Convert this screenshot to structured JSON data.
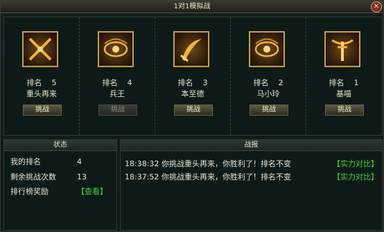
{
  "window": {
    "title": "1对1模拟战",
    "close_icon": "close-icon"
  },
  "colors": {
    "gold_frame": "#c89e4c",
    "link_green": "#39d43a",
    "panel_bg": "#0d1a18"
  },
  "opponents": [
    {
      "rank_label": "排名",
      "rank": "5",
      "name": "重头再来",
      "button": "挑战",
      "button_enabled": true,
      "icon": "crossed-swords-icon"
    },
    {
      "rank_label": "排名",
      "rank": "4",
      "name": "兵王",
      "button": "挑战",
      "button_enabled": false,
      "icon": "mystic-eye-icon"
    },
    {
      "rank_label": "排名",
      "rank": "3",
      "name": "本至德",
      "button": "挑战",
      "button_enabled": true,
      "icon": "curved-blade-icon"
    },
    {
      "rank_label": "排名",
      "rank": "2",
      "name": "马小玲",
      "button": "挑战",
      "button_enabled": true,
      "icon": "mystic-eye-icon"
    },
    {
      "rank_label": "排名",
      "rank": "1",
      "name": "基喵",
      "button": "挑战",
      "button_enabled": true,
      "icon": "horned-sword-icon"
    }
  ],
  "status": {
    "header": "状态",
    "my_rank_label": "我的排名",
    "my_rank_value": "4",
    "challenges_left_label": "剩余挑战次数",
    "challenges_left_value": "13",
    "ranking_reward_label": "排行榜奖励",
    "ranking_reward_link": "【查看】"
  },
  "battle_report": {
    "header": "战报",
    "entries": [
      {
        "time": "18:38:32",
        "message": "你挑战重头再来，你胜利了！排名不变",
        "link": "【实力对比】"
      },
      {
        "time": "18:37:52",
        "message": "你挑战重头再来，你胜利了！排名不变",
        "link": "【实力对比】"
      }
    ]
  }
}
